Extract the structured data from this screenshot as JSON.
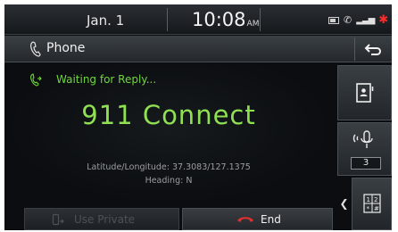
{
  "status": {
    "date": "Jan.  1",
    "time": "10:08",
    "ampm": "AM"
  },
  "header": {
    "title": "Phone"
  },
  "call": {
    "status": "Waiting for Reply...",
    "name": "911 Connect",
    "coordinates": "Latitude/Longitude: 37.3083/127.1375",
    "heading": "Heading: N"
  },
  "actions": {
    "use_private": "Use Private",
    "end": "End"
  },
  "sidebar": {
    "mic_count": "3"
  },
  "colors": {
    "accent_green": "#8fe052",
    "end_red": "#e03030",
    "bt_red": "#ff2a2a"
  },
  "icons": [
    "phone-icon",
    "back-icon",
    "outgoing-call-icon",
    "contacts-icon",
    "mic-volume-icon",
    "keypad-icon",
    "end-call-icon",
    "private-handset-icon"
  ]
}
